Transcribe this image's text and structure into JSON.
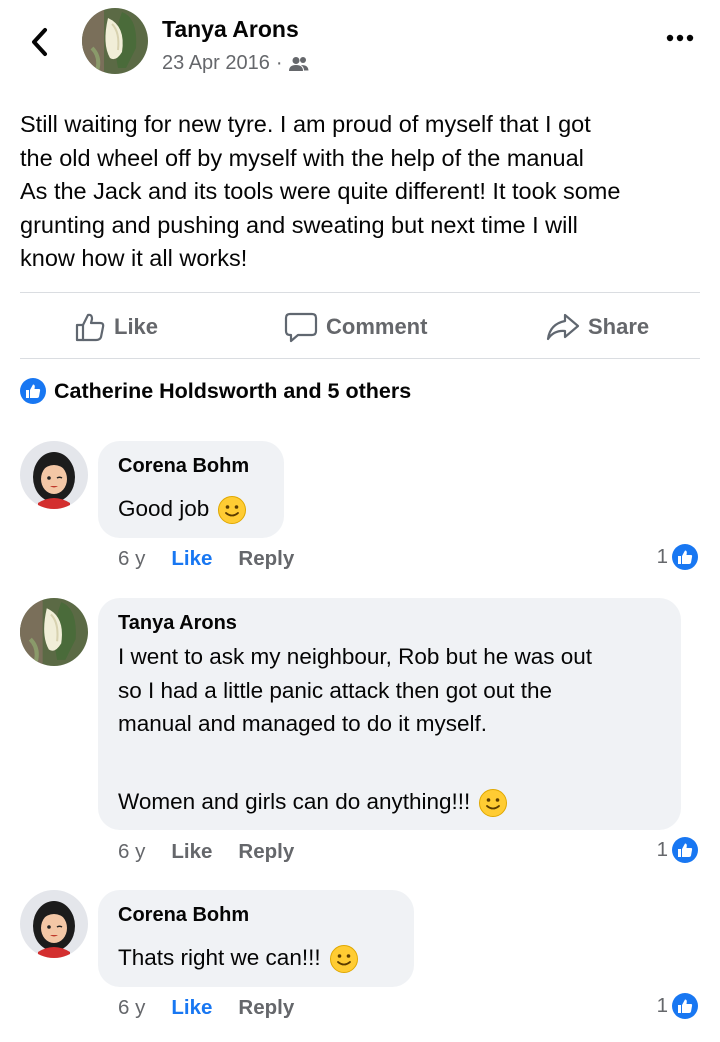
{
  "header": {
    "author": "Tanya Arons",
    "date": "23 Apr 2016",
    "separator": "·",
    "back_icon": "chevron-left-icon",
    "audience_icon": "friends-icon",
    "more_icon": "more-dots-icon"
  },
  "post": {
    "lines": [
      "Still waiting for new tyre.  I am proud of myself that I got",
      "the old wheel off by myself with the help of the manual",
      "As the Jack and its tools were quite different!  It took some",
      "grunting and pushing and sweating but next time I will",
      "know how it all works!"
    ]
  },
  "actions": {
    "like": "Like",
    "comment": "Comment",
    "share": "Share"
  },
  "reactions": {
    "summary": "Catherine Holdsworth and 5 others"
  },
  "comments": [
    {
      "author": "Corena Bohm",
      "lines": [
        "Good job"
      ],
      "age": "6 y",
      "like": "Like",
      "reply": "Reply",
      "like_count": "1",
      "liked": true
    },
    {
      "author": "Tanya Arons",
      "lines": [
        "I went to ask my neighbour, Rob but he was out",
        "so I had a little panic attack then got out the",
        "manual and managed to do it myself.",
        "",
        "Women and girls can do anything!!!"
      ],
      "age": "6 y",
      "like": "Like",
      "reply": "Reply",
      "like_count": "1",
      "liked": false
    },
    {
      "author": "Corena Bohm",
      "lines": [
        "Thats right we can!!!"
      ],
      "age": "6 y",
      "like": "Like",
      "reply": "Reply",
      "like_count": "1",
      "liked": true
    }
  ],
  "colors": {
    "accent": "#1877f2",
    "muted": "#65676b",
    "bubble": "#f0f2f5"
  }
}
